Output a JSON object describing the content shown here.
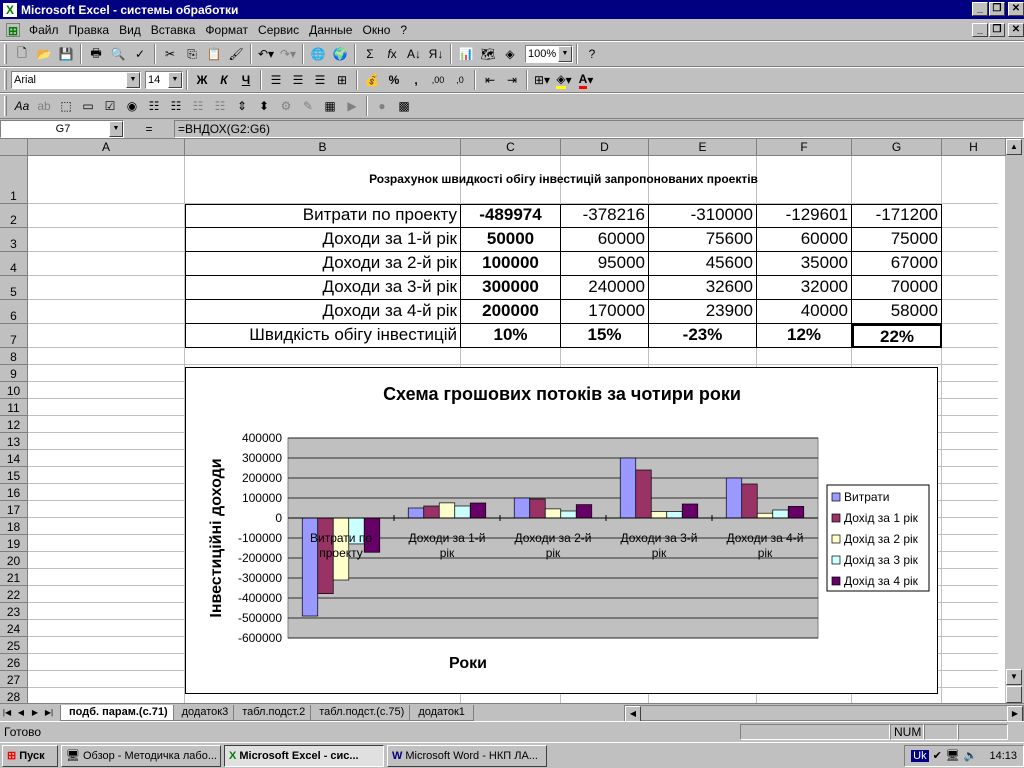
{
  "window": {
    "title": "Microsoft Excel - системы обработки"
  },
  "menu": [
    "Файл",
    "Правка",
    "Вид",
    "Вставка",
    "Формат",
    "Сервис",
    "Данные",
    "Окно",
    "?"
  ],
  "toolbar": {
    "zoom": "100%",
    "font": "Arial",
    "size": "14"
  },
  "formula": {
    "cell_ref": "G7",
    "eq": "=",
    "content": "=ВНДОХ(G2:G6)"
  },
  "columns": [
    "A",
    "B",
    "C",
    "D",
    "E",
    "F",
    "G",
    "H"
  ],
  "rows": [
    "1",
    "2",
    "3",
    "4",
    "5",
    "6",
    "7",
    "8",
    "9",
    "10",
    "11",
    "12",
    "13",
    "14",
    "15",
    "16",
    "17",
    "18",
    "19",
    "20",
    "21",
    "22",
    "23",
    "24",
    "25",
    "26",
    "27",
    "28"
  ],
  "sheet": {
    "heading": "Розрахунок швидкості обігу інвестицій запропонованих проектів",
    "table": [
      {
        "label": "Витрати по проекту",
        "vals": [
          "-489974",
          "-378216",
          "-310000",
          "-129601",
          "-171200"
        ]
      },
      {
        "label": "Доходи за 1-й рік",
        "vals": [
          "50000",
          "60000",
          "75600",
          "60000",
          "75000"
        ]
      },
      {
        "label": "Доходи за 2-й рік",
        "vals": [
          "100000",
          "95000",
          "45600",
          "35000",
          "67000"
        ]
      },
      {
        "label": "Доходи за 3-й рік",
        "vals": [
          "300000",
          "240000",
          "32600",
          "32000",
          "70000"
        ]
      },
      {
        "label": "Доходи за 4-й рік",
        "vals": [
          "200000",
          "170000",
          "23900",
          "40000",
          "58000"
        ]
      },
      {
        "label": "Швидкість обігу інвестицій",
        "vals": [
          "10%",
          "15%",
          "-23%",
          "12%",
          "22%"
        ]
      }
    ]
  },
  "chart_data": {
    "type": "bar",
    "title": "Схема грошових потоків за чотири роки",
    "xlabel": "Роки",
    "ylabel": "Інвестиційні доходи",
    "categories": [
      "Витрати по проекту",
      "Доходи за 1-й рік",
      "Доходи за 2-й рік",
      "Доходи за 3-й рік",
      "Доходи за 4-й рік"
    ],
    "ylim": [
      -600000,
      400000
    ],
    "yticks": [
      "400000",
      "300000",
      "200000",
      "100000",
      "0",
      "-100000",
      "-200000",
      "-300000",
      "-400000",
      "-500000",
      "-600000"
    ],
    "series": [
      {
        "name": "Витрати",
        "color": "#9999ff",
        "values": [
          -489974,
          50000,
          100000,
          300000,
          200000
        ]
      },
      {
        "name": "Дохід за 1 рік",
        "color": "#993366",
        "values": [
          -378216,
          60000,
          95000,
          240000,
          170000
        ]
      },
      {
        "name": "Дохід за 2 рік",
        "color": "#ffffcc",
        "values": [
          -310000,
          75600,
          45600,
          32600,
          23900
        ]
      },
      {
        "name": "Дохід за 3 рік",
        "color": "#ccffff",
        "values": [
          -129601,
          60000,
          35000,
          32000,
          40000
        ]
      },
      {
        "name": "Дохід за 4 рік",
        "color": "#660066",
        "values": [
          -171200,
          75000,
          67000,
          70000,
          58000
        ]
      }
    ],
    "legend": "right",
    "grid": true,
    "plot_bg": "#c0c0c0"
  },
  "tabs": [
    "подб. парам.(с.71)",
    "додаток3",
    "табл.подст.2",
    "табл.подст.(с.75)",
    "додаток1"
  ],
  "status": {
    "ready": "Готово",
    "num": "NUM"
  },
  "taskbar": {
    "start": "Пуск",
    "tasks": [
      "Обзор - Методичка лабо...",
      "Microsoft Excel - сис...",
      "Microsoft Word - НКП ЛА..."
    ],
    "lang": "Uk",
    "time": "14:13"
  }
}
